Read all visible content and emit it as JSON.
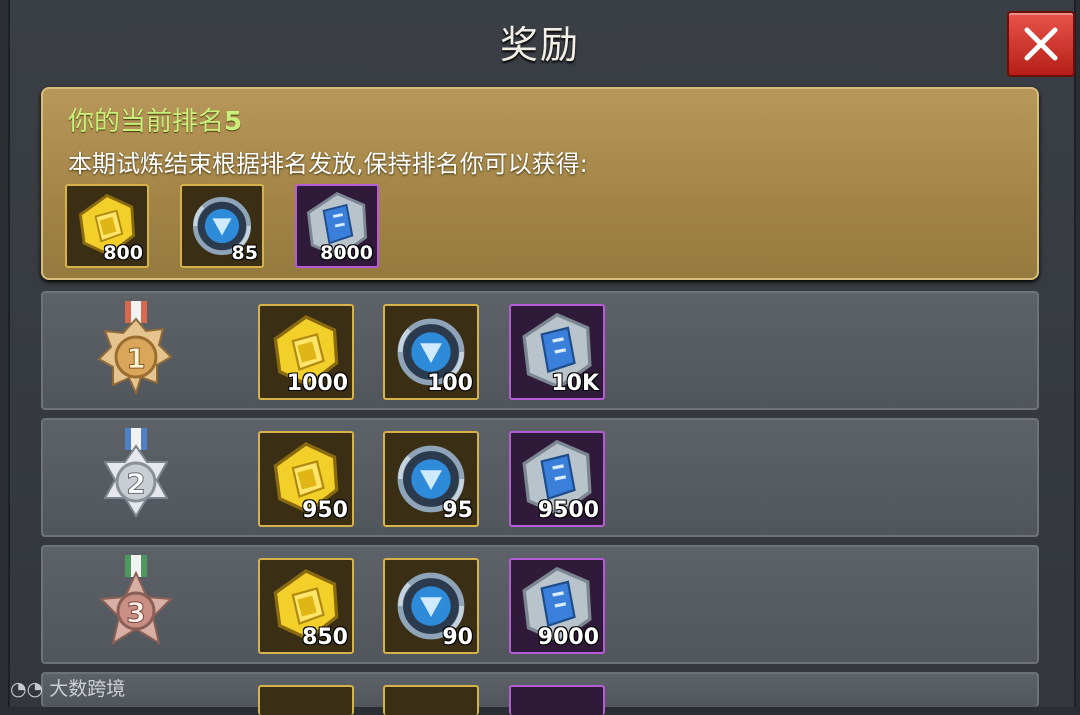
{
  "title": "奖励",
  "rank_box": {
    "label": "你的当前排名",
    "rank": "5",
    "description": "本期试炼结束根据排名发放,保持排名你可以获得:",
    "rewards": [
      {
        "icon": "gold-bar-icon",
        "amount": "800"
      },
      {
        "icon": "crystal-core-icon",
        "amount": "85"
      },
      {
        "icon": "blue-scroll-icon",
        "amount": "8000"
      }
    ]
  },
  "rank_rows": [
    {
      "medal": "1",
      "medal_icon": "gold-medal-icon",
      "rewards": [
        {
          "icon": "gold-bar-icon",
          "amount": "1000"
        },
        {
          "icon": "crystal-core-icon",
          "amount": "100"
        },
        {
          "icon": "blue-scroll-icon",
          "amount": "10K"
        }
      ]
    },
    {
      "medal": "2",
      "medal_icon": "silver-medal-icon",
      "rewards": [
        {
          "icon": "gold-bar-icon",
          "amount": "950"
        },
        {
          "icon": "crystal-core-icon",
          "amount": "95"
        },
        {
          "icon": "blue-scroll-icon",
          "amount": "9500"
        }
      ]
    },
    {
      "medal": "3",
      "medal_icon": "bronze-medal-icon",
      "rewards": [
        {
          "icon": "gold-bar-icon",
          "amount": "850"
        },
        {
          "icon": "crystal-core-icon",
          "amount": "90"
        },
        {
          "icon": "blue-scroll-icon",
          "amount": "9000"
        }
      ]
    }
  ],
  "watermark": "大数跨境",
  "colors": {
    "accent_green": "#c8f07a",
    "gold_border": "#d6b24a",
    "purple_border": "#b65bd6",
    "close_red": "#d63a30"
  }
}
